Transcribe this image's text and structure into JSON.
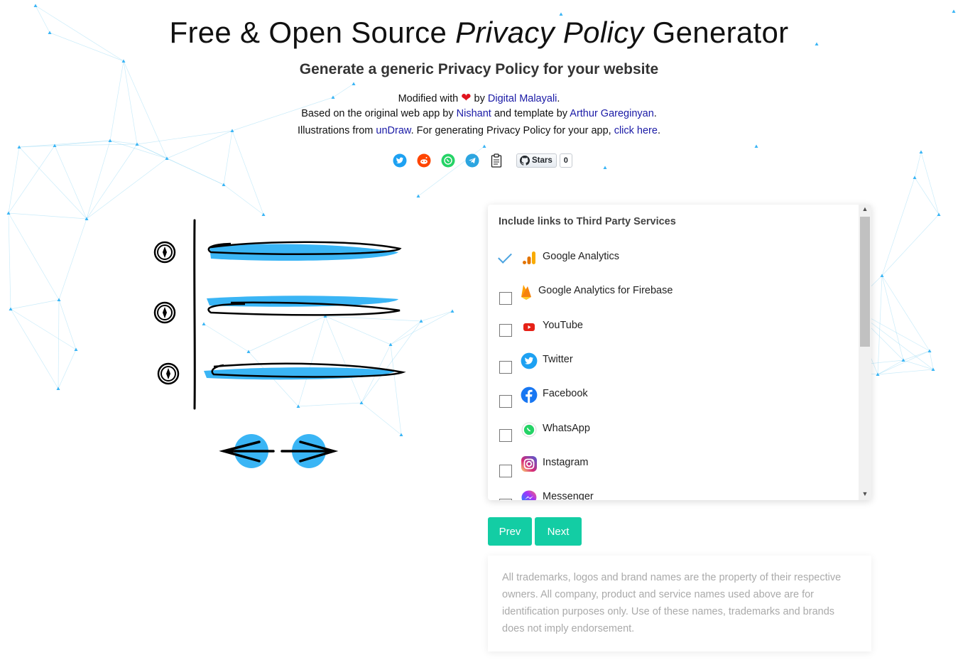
{
  "header": {
    "title_start": "Free & Open Source ",
    "title_em": "Privacy Policy",
    "title_end": " Generator",
    "subtitle": "Generate a generic Privacy Policy for your website",
    "line1": {
      "pre": "Modified with",
      "heart": "❤",
      "mid": "by",
      "link": "Digital Malayali",
      "post": "."
    },
    "line2": {
      "pre": "Based on the original web app by",
      "link1": "Nishant",
      "mid": "and template by",
      "link2": "Arthur Gareginyan",
      "post": "."
    },
    "line3": {
      "pre": "Illustrations from",
      "link1": "unDraw",
      "mid": ". For generating Privacy Policy for your app,",
      "link2": "click here",
      "post": "."
    }
  },
  "share": {
    "icons": [
      "twitter-icon",
      "reddit-icon",
      "whatsapp-icon",
      "telegram-icon",
      "clipboard-icon"
    ],
    "github_label": "Stars",
    "github_count": "0"
  },
  "panel": {
    "heading": "Include links to Third Party Services",
    "services": [
      {
        "name": "Google Analytics",
        "icon": "google-analytics-icon",
        "checked": true
      },
      {
        "name": "Google Analytics for Firebase",
        "icon": "firebase-icon",
        "checked": false
      },
      {
        "name": "YouTube",
        "icon": "youtube-icon",
        "checked": false
      },
      {
        "name": "Twitter",
        "icon": "twitter-icon",
        "checked": false
      },
      {
        "name": "Facebook",
        "icon": "facebook-icon",
        "checked": false
      },
      {
        "name": "WhatsApp",
        "icon": "whatsapp-icon",
        "checked": false
      },
      {
        "name": "Instagram",
        "icon": "instagram-icon",
        "checked": false
      },
      {
        "name": "Messenger",
        "icon": "messenger-icon",
        "checked": false
      }
    ]
  },
  "buttons": {
    "prev": "Prev",
    "next": "Next"
  },
  "disclaimer": "All trademarks, logos and brand names are the property of their respective owners. All company, product and service names used above are for identification purposes only. Use of these names, trademarks and brands does not imply endorsement.",
  "colors": {
    "accent": "#13cda4",
    "link": "#1a1aa6",
    "illustration": "#3ab5f5"
  }
}
